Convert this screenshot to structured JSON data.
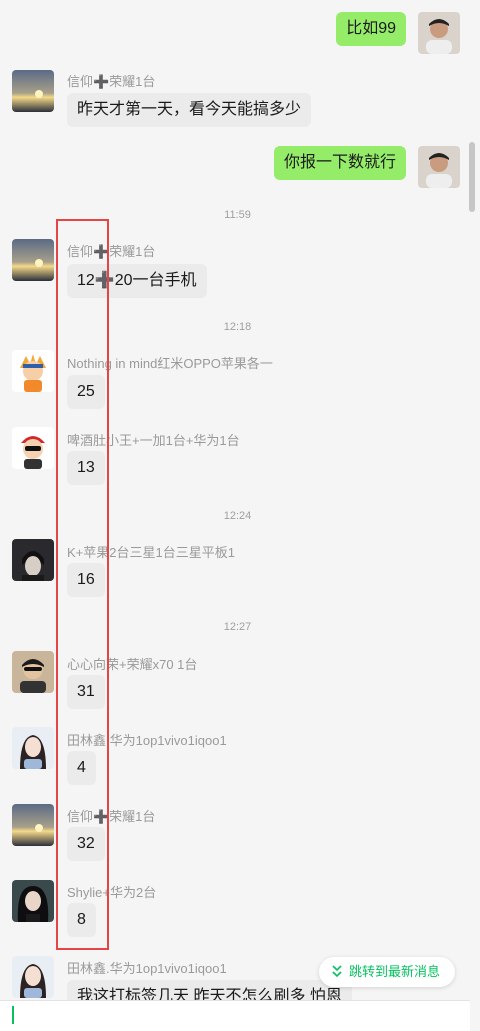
{
  "messages": [
    {
      "type": "out",
      "text": "比如99",
      "avatar": "avatar-man"
    },
    {
      "type": "in",
      "sender": "信仰➕荣耀1台",
      "text": "昨天才第一天，看今天能搞多少",
      "avatar": "sunset-avatar"
    },
    {
      "type": "out",
      "text": "你报一下数就行",
      "avatar": "avatar-man"
    },
    {
      "type": "time",
      "text": "11:59"
    },
    {
      "type": "in",
      "sender": "信仰➕荣耀1台",
      "text": "12➕20一台手机",
      "avatar": "sunset-avatar"
    },
    {
      "type": "time",
      "text": "12:18"
    },
    {
      "type": "in",
      "sender": "Nothing in mind红米OPPO苹果各一",
      "text": "25",
      "avatar": "cartoon-ninja-avatar"
    },
    {
      "type": "in",
      "sender": "啤酒肚小王+一加1台+华为1台",
      "text": "13",
      "avatar": "cartoon-red-cap-avatar"
    },
    {
      "type": "time",
      "text": "12:24"
    },
    {
      "type": "in",
      "sender": "K+苹果2台三星1台三星平板1",
      "text": "16",
      "avatar": "anime-dark-avatar"
    },
    {
      "type": "time",
      "text": "12:27"
    },
    {
      "type": "in",
      "sender": "心心向荣+荣耀x70 1台",
      "text": "31",
      "avatar": "sunglasses-avatar"
    },
    {
      "type": "in",
      "sender": "田林鑫.华为1op1vivo1iqoo1",
      "text": "4",
      "avatar": "woman-avatar"
    },
    {
      "type": "in",
      "sender": "信仰➕荣耀1台",
      "text": "32",
      "avatar": "sunset-avatar"
    },
    {
      "type": "in",
      "sender": "Shylie+华为2台",
      "text": "8",
      "avatar": "dark-hair-avatar"
    },
    {
      "type": "in",
      "sender": "田林鑫.华为1op1vivo1iqoo1",
      "text": "我这打标签几天 昨天不怎么刷多 怕恩",
      "avatar": "woman-avatar"
    }
  ],
  "jump_button": {
    "label": "跳转到最新消息",
    "icon": "double-chevron-down-icon"
  },
  "colors": {
    "out_bubble": "#95ec69",
    "in_bubble": "#ebebeb",
    "highlight": "#e64545",
    "accent": "#07c160"
  }
}
